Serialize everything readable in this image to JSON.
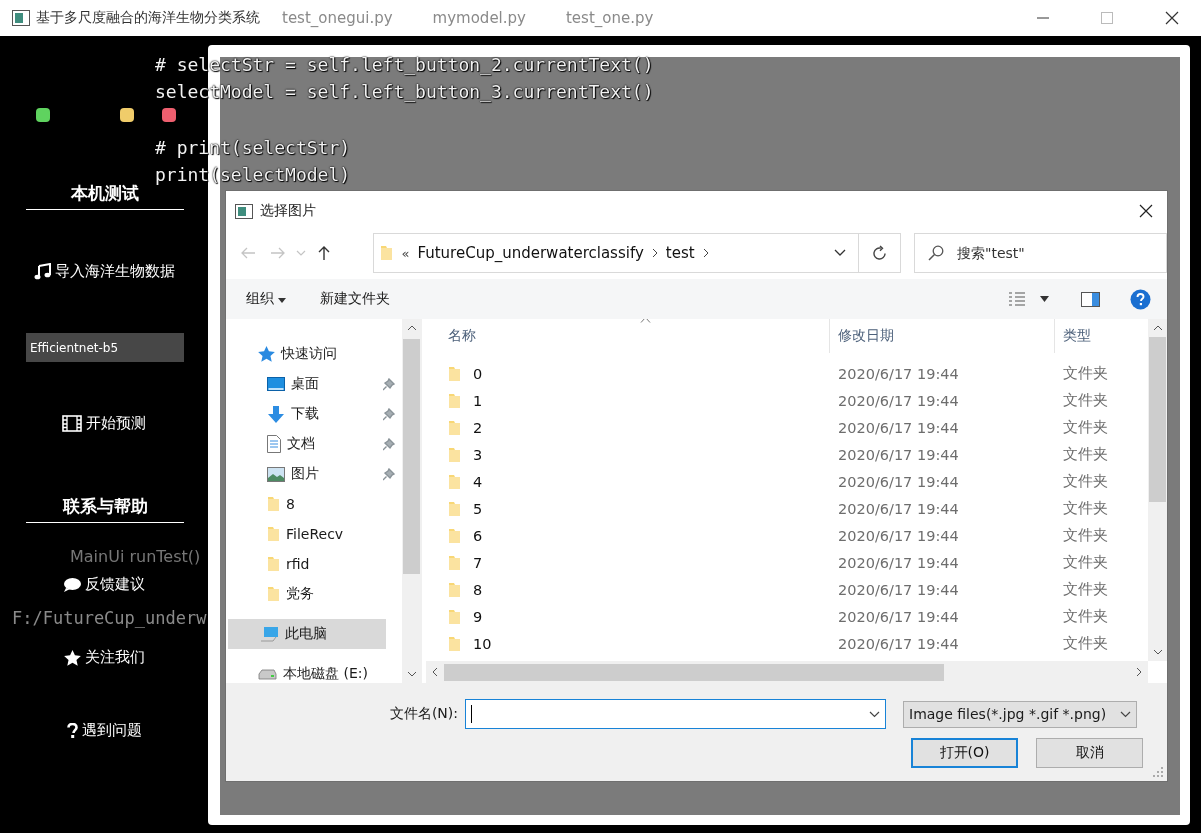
{
  "window": {
    "title": "基于多尺度融合的海洋生物分类系统"
  },
  "background_editor": {
    "tabs": [
      "test_onegui.py",
      "mymodel.py",
      "test_one.py"
    ],
    "code_lines": [
      "# selectStr = self.left_button_2.currentText()",
      "selectModel = self.left_button_3.currentText()",
      "# print(selectStr)",
      "print(selectModel)"
    ],
    "breadcrumb": "MainUi  runTest()",
    "path": "F:/FutureCup_underw"
  },
  "sidebar": {
    "dots": [
      {
        "color": "#5fd35f"
      },
      {
        "color": "#f0cc6a"
      },
      {
        "color": "#ee5f6f"
      }
    ],
    "items": [
      {
        "kind": "heading",
        "label": "本机测试"
      },
      {
        "kind": "import",
        "label": "导入海洋生物数据"
      },
      {
        "kind": "select",
        "value": "Efficientnet-b5"
      },
      {
        "kind": "predict",
        "label": "开始预测"
      },
      {
        "kind": "heading",
        "label": "联系与帮助"
      },
      {
        "kind": "feedback",
        "label": "反馈建议"
      },
      {
        "kind": "follow",
        "label": "关注我们"
      },
      {
        "kind": "problem",
        "label": "遇到问题"
      }
    ]
  },
  "dialog": {
    "title": "选择图片",
    "nav_buttons": [
      {
        "kind": "back",
        "disabled": true
      },
      {
        "kind": "forward",
        "disabled": true
      },
      {
        "kind": "recent",
        "disabled": true
      },
      {
        "kind": "up",
        "disabled": false
      }
    ],
    "address": {
      "overflow": "«",
      "crumbs": [
        "FutureCup_underwaterclassify",
        "test"
      ]
    },
    "search": {
      "placeholder": "搜索\"test\""
    },
    "toolbar": {
      "organize": "组织",
      "new_folder": "新建文件夹"
    },
    "nav_pane": [
      {
        "kind": "quick",
        "label": "快速访问",
        "selected": false,
        "children": [
          {
            "kind": "desktop",
            "label": "桌面",
            "pinned": true
          },
          {
            "kind": "downloads",
            "label": "下载",
            "pinned": true
          },
          {
            "kind": "documents",
            "label": "文档",
            "pinned": true
          },
          {
            "kind": "pictures",
            "label": "图片",
            "pinned": true
          },
          {
            "kind": "folder",
            "label": "8",
            "pinned": false
          },
          {
            "kind": "folder",
            "label": "FileRecv",
            "pinned": false
          },
          {
            "kind": "folder",
            "label": "rfid",
            "pinned": false
          },
          {
            "kind": "folder",
            "label": "党务",
            "pinned": false
          }
        ]
      },
      {
        "kind": "pc",
        "label": "此电脑",
        "selected": true
      },
      {
        "kind": "drive",
        "label": "本地磁盘 (E:)",
        "selected": false
      }
    ],
    "columns": [
      "名称",
      "修改日期",
      "类型"
    ],
    "rows": [
      {
        "name": "0",
        "date": "2020/6/17 19:44",
        "type": "文件夹"
      },
      {
        "name": "1",
        "date": "2020/6/17 19:44",
        "type": "文件夹"
      },
      {
        "name": "2",
        "date": "2020/6/17 19:44",
        "type": "文件夹"
      },
      {
        "name": "3",
        "date": "2020/6/17 19:44",
        "type": "文件夹"
      },
      {
        "name": "4",
        "date": "2020/6/17 19:44",
        "type": "文件夹"
      },
      {
        "name": "5",
        "date": "2020/6/17 19:44",
        "type": "文件夹"
      },
      {
        "name": "6",
        "date": "2020/6/17 19:44",
        "type": "文件夹"
      },
      {
        "name": "7",
        "date": "2020/6/17 19:44",
        "type": "文件夹"
      },
      {
        "name": "8",
        "date": "2020/6/17 19:44",
        "type": "文件夹"
      },
      {
        "name": "9",
        "date": "2020/6/17 19:44",
        "type": "文件夹"
      },
      {
        "name": "10",
        "date": "2020/6/17 19:44",
        "type": "文件夹"
      }
    ],
    "file_name": {
      "label": "文件名(N):"
    },
    "file_type": "Image files(*.jpg *.gif *.png)",
    "buttons": [
      {
        "label": "打开(O)",
        "default": true
      },
      {
        "label": "取消",
        "default": false
      }
    ]
  }
}
